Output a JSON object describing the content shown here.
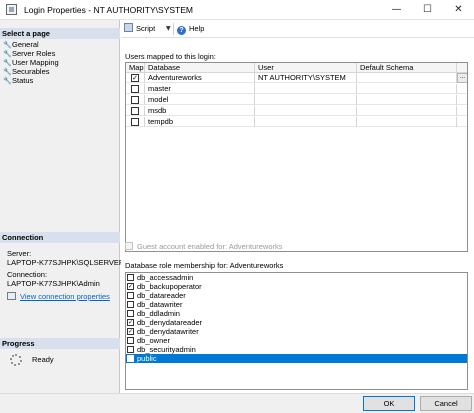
{
  "window": {
    "title": "Login Properties - NT AUTHORITY\\SYSTEM",
    "minimize_glyph": "—",
    "maximize_glyph": "☐",
    "close_glyph": "✕"
  },
  "left_pane": {
    "select_page_header": "Select a page",
    "pages": [
      {
        "label": "General",
        "icon": "wrench-icon"
      },
      {
        "label": "Server Roles",
        "icon": "wrench-icon"
      },
      {
        "label": "User Mapping",
        "icon": "wrench-icon"
      },
      {
        "label": "Securables",
        "icon": "wrench-icon"
      },
      {
        "label": "Status",
        "icon": "wrench-icon"
      }
    ],
    "page_icon_glyph": "🔧",
    "connection_header": "Connection",
    "server_label": "Server:",
    "server_value": "LAPTOP-K77SJHPK\\SQLSERVER",
    "connection_label": "Connection:",
    "connection_value": "LAPTOP-K77SJHPK\\Admin",
    "view_connection_link": "View connection properties",
    "progress_header": "Progress",
    "progress_status": "Ready"
  },
  "toolbar": {
    "script_label": "Script",
    "dropdown_glyph": "▼",
    "help_label": "Help",
    "help_glyph": "?"
  },
  "users_mapped": {
    "label": "Users mapped to this login:",
    "columns": [
      "Map",
      "Database",
      "User",
      "Default Schema"
    ],
    "check_glyph": "✓",
    "ellipsis": "...",
    "rows": [
      {
        "mapped": true,
        "database": "Adventureworks",
        "user": "NT AUTHORITY\\SYSTEM",
        "schema": ""
      },
      {
        "mapped": false,
        "database": "master",
        "user": "",
        "schema": ""
      },
      {
        "mapped": false,
        "database": "model",
        "user": "",
        "schema": ""
      },
      {
        "mapped": false,
        "database": "msdb",
        "user": "",
        "schema": ""
      },
      {
        "mapped": false,
        "database": "tempdb",
        "user": "",
        "schema": ""
      }
    ]
  },
  "guest_text": "Guest account enabled for: Adventureworks",
  "role_membership": {
    "label": "Database role membership for: Adventureworks",
    "roles": [
      {
        "name": "db_accessadmin",
        "checked": false,
        "selected": false
      },
      {
        "name": "db_backupoperator",
        "checked": true,
        "selected": false
      },
      {
        "name": "db_datareader",
        "checked": false,
        "selected": false
      },
      {
        "name": "db_datawriter",
        "checked": false,
        "selected": false
      },
      {
        "name": "db_ddladmin",
        "checked": false,
        "selected": false
      },
      {
        "name": "db_denydatareader",
        "checked": true,
        "selected": false
      },
      {
        "name": "db_denydatawriter",
        "checked": true,
        "selected": false
      },
      {
        "name": "db_owner",
        "checked": false,
        "selected": false
      },
      {
        "name": "db_securityadmin",
        "checked": false,
        "selected": false
      },
      {
        "name": "public",
        "checked": true,
        "selected": true
      }
    ]
  },
  "footer": {
    "ok_label": "OK",
    "cancel_label": "Cancel"
  },
  "colors": {
    "selection": "#0078d7",
    "section_header": "#d7e0ec",
    "link": "#0066cc"
  }
}
